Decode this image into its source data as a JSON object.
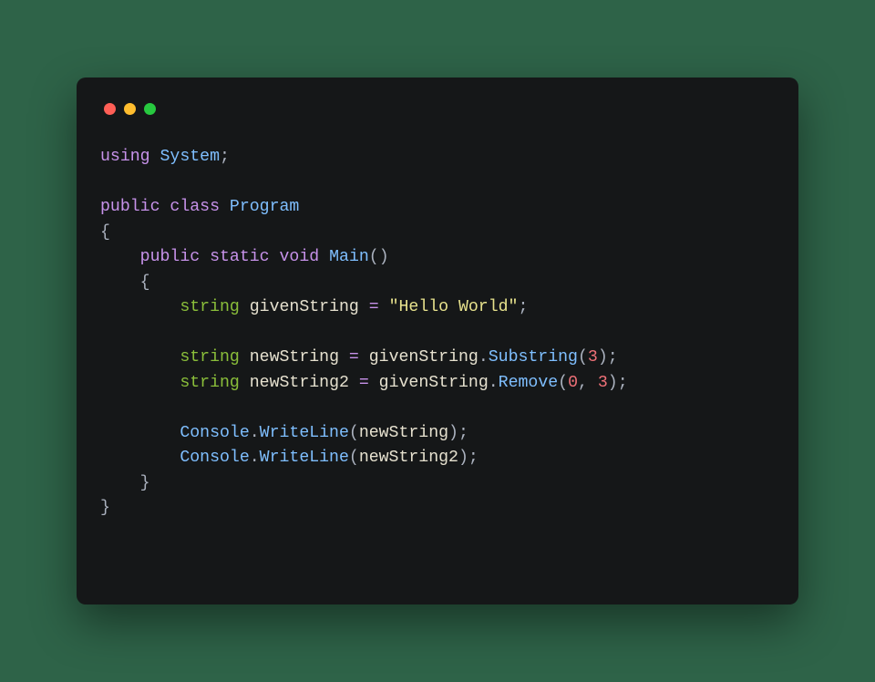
{
  "code": {
    "l1": {
      "kw_using": "using",
      "ns": "System",
      "semi": ";"
    },
    "l2": "",
    "l3": {
      "kw_public": "public",
      "kw_class": "class",
      "name": "Program"
    },
    "l4": {
      "brace": "{"
    },
    "l5": {
      "indent": "    ",
      "kw_public": "public",
      "kw_static": "static",
      "kw_void": "void",
      "name": "Main",
      "paren": "()"
    },
    "l6": {
      "indent": "    ",
      "brace": "{"
    },
    "l7": {
      "indent": "        ",
      "kw_string": "string",
      "var": "givenString",
      "eq": "=",
      "str": "\"Hello World\"",
      "semi": ";"
    },
    "l8": "",
    "l9": {
      "indent": "        ",
      "kw_string": "string",
      "var": "newString",
      "eq": "=",
      "src": "givenString",
      "dot": ".",
      "fn": "Substring",
      "po": "(",
      "args": [
        {
          "n": "3"
        }
      ],
      "pc": ")",
      "semi": ";"
    },
    "l10": {
      "indent": "        ",
      "kw_string": "string",
      "var": "newString2",
      "eq": "=",
      "src": "givenString",
      "dot": ".",
      "fn": "Remove",
      "po": "(",
      "args": [
        {
          "n": "0"
        },
        {
          "n": "3"
        }
      ],
      "comma": ", ",
      "pc": ")",
      "semi": ";"
    },
    "l11": "",
    "l12": {
      "indent": "        ",
      "obj": "Console",
      "dot": ".",
      "fn": "WriteLine",
      "po": "(",
      "arg": "newString",
      "pc": ")",
      "semi": ";"
    },
    "l13": {
      "indent": "        ",
      "obj": "Console",
      "dot": ".",
      "fn": "WriteLine",
      "po": "(",
      "arg": "newString2",
      "pc": ")",
      "semi": ";"
    },
    "l14": {
      "indent": "    ",
      "brace": "}"
    },
    "l15": {
      "brace": "}"
    }
  }
}
